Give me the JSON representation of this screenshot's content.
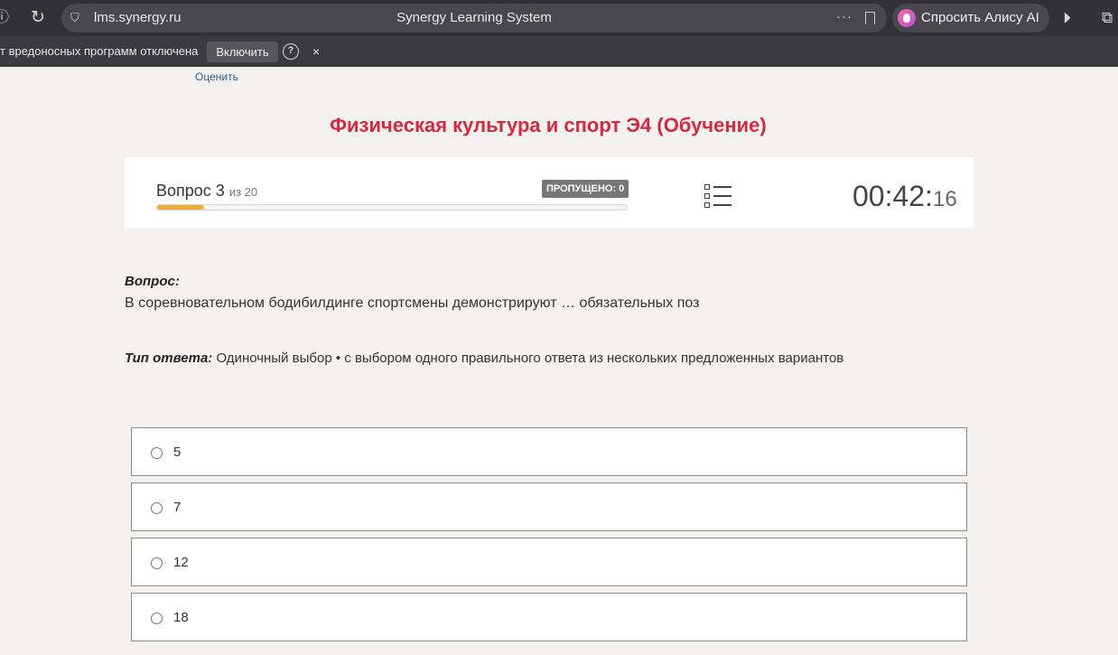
{
  "browser": {
    "domain": "lms.synergy.ru",
    "page_title": "Synergy Learning System",
    "alice_label": "Спросить Алису AI",
    "infobar_message": "т вредоносных программ отключена",
    "enable_button": "Включить",
    "help_glyph": "?",
    "close_glyph": "×"
  },
  "page": {
    "rate_link": "Оценить",
    "course_title": "Физическая культура и спорт Э4 (Обучение)"
  },
  "progress": {
    "question_label": "Вопрос 3",
    "of_label": "из 20",
    "current": 3,
    "total": 20,
    "fill_fraction": 0.1,
    "skipped_label": "ПРОПУЩЕНО: 0",
    "timer_main": "00:42:",
    "timer_seconds": "16",
    "fill_color": "#f0ad37"
  },
  "question": {
    "heading": "Вопрос:",
    "text": "В соревновательном бодибилдинге спортсмены демонстрируют … обязательных поз",
    "answer_type_label": "Тип ответа:",
    "answer_type_value": "Одиночный выбор • с выбором одного правильного ответа из нескольких предложенных вариантов"
  },
  "options": [
    {
      "label": "5"
    },
    {
      "label": "7"
    },
    {
      "label": "12"
    },
    {
      "label": "18"
    }
  ],
  "colors": {
    "title_red": "#d7283e",
    "link_blue": "#2b5d93",
    "page_bg": "#f3f2ef"
  }
}
